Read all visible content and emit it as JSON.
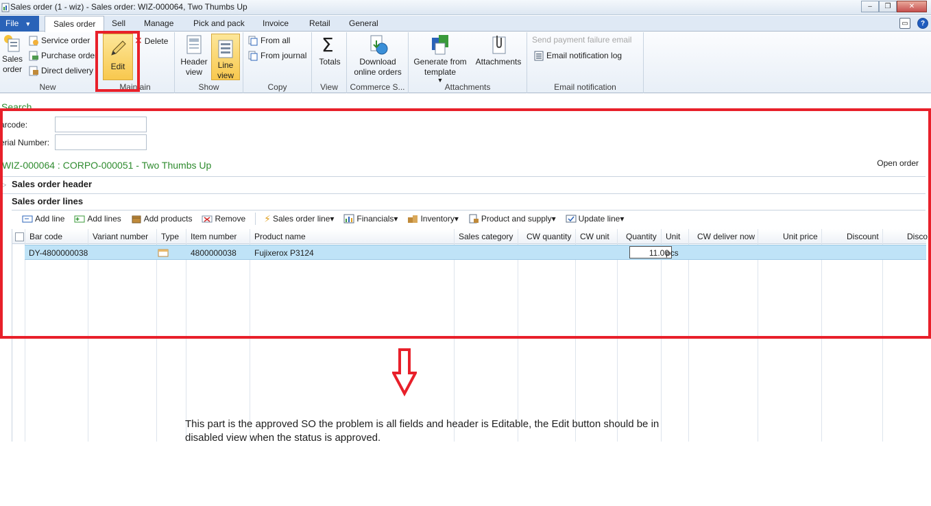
{
  "window": {
    "title": "Sales order (1 - wiz) - Sales order: WIZ-000064, Two Thumbs Up",
    "minimize": "–",
    "maximize": "❐",
    "close": "✕"
  },
  "tabs": {
    "file": "File",
    "items": [
      "Sales order",
      "Sell",
      "Manage",
      "Pick and pack",
      "Invoice",
      "Retail",
      "General"
    ]
  },
  "ribbon": {
    "new_group": {
      "label": "New",
      "sales_order": "Sales order",
      "service_order": "Service order",
      "purchase_order": "Purchase order",
      "direct_delivery": "Direct delivery"
    },
    "maintain_group": {
      "label": "Maintain",
      "edit": "Edit",
      "delete": "Delete"
    },
    "show_group": {
      "label": "Show",
      "header_view": "Header view",
      "line_view": "Line view"
    },
    "copy_group": {
      "label": "Copy",
      "from_all": "From all",
      "from_journal": "From journal"
    },
    "view_group": {
      "label": "View",
      "totals": "Totals"
    },
    "commerce_group": {
      "label": "Commerce S...",
      "download": "Download online orders"
    },
    "attachments_group": {
      "label": "Attachments",
      "generate": "Generate from template",
      "attachments": "Attachments"
    },
    "email_group": {
      "label": "Email notification",
      "send_payment": "Send payment failure email",
      "email_log": "Email notification log"
    }
  },
  "content": {
    "search": "Search",
    "barcode_label": "arcode:",
    "serial_label": "erial Number:",
    "record_title": "WIZ-000064 : CORPO-000051 - Two Thumbs Up",
    "status": "Open order",
    "header_section": "Sales order header",
    "lines_section": "Sales order lines"
  },
  "lines_toolbar": {
    "add_line": "Add line",
    "add_lines": "Add lines",
    "add_products": "Add products",
    "remove": "Remove",
    "sales_order_line": "Sales order line▾",
    "financials": "Financials▾",
    "inventory": "Inventory▾",
    "product_supply": "Product and supply▾",
    "update_line": "Update line▾"
  },
  "grid": {
    "columns": [
      "Bar code",
      "Variant number",
      "Type",
      "Item number",
      "Product name",
      "Sales category",
      "CW quantity",
      "CW unit",
      "Quantity",
      "Unit",
      "CW deliver now",
      "Unit price",
      "Discount",
      "Disco"
    ],
    "rows": [
      {
        "bar_code": "DY-4800000038",
        "variant_number": "",
        "item_number": "4800000038",
        "product_name": "Fujixerox P3124",
        "quantity": "11.00",
        "unit": "pcs"
      }
    ]
  },
  "annotation": "This part is the approved SO the problem is all fields and header is Editable, the Edit button should be in disabled view when the status is approved.",
  "colors": {
    "accent_red": "#e8202a",
    "link_green": "#2e8b2e",
    "file_tab_blue": "#2a63b8",
    "selected_row": "#bfe3f7"
  }
}
